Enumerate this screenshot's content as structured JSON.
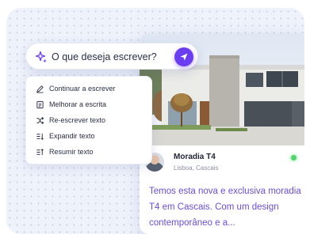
{
  "search": {
    "placeholder": "O que deseja escrever?",
    "icon": "sparkle-icon",
    "send_icon": "send-icon"
  },
  "menu": {
    "items": [
      {
        "label": "Continuar a escrever",
        "icon": "pen-icon"
      },
      {
        "label": "Melhorar a escrita",
        "icon": "document-icon"
      },
      {
        "label": "Re-escrever texto",
        "icon": "shuffle-icon"
      },
      {
        "label": "Expandir texto",
        "icon": "expand-lines-icon"
      },
      {
        "label": "Resumir texto",
        "icon": "summarize-lines-icon"
      }
    ]
  },
  "listing": {
    "title": "Moradia T4",
    "location": "Lisboa, Cascais",
    "description": "Temos esta nova e exclusiva moradia T4 em Cascais. Com um design contemporâneo e a..."
  },
  "colors": {
    "accent": "#6b3df0",
    "text_accent": "#6a4fd8",
    "online": "#4fd66a",
    "panel_bg": "#eef2fb"
  }
}
